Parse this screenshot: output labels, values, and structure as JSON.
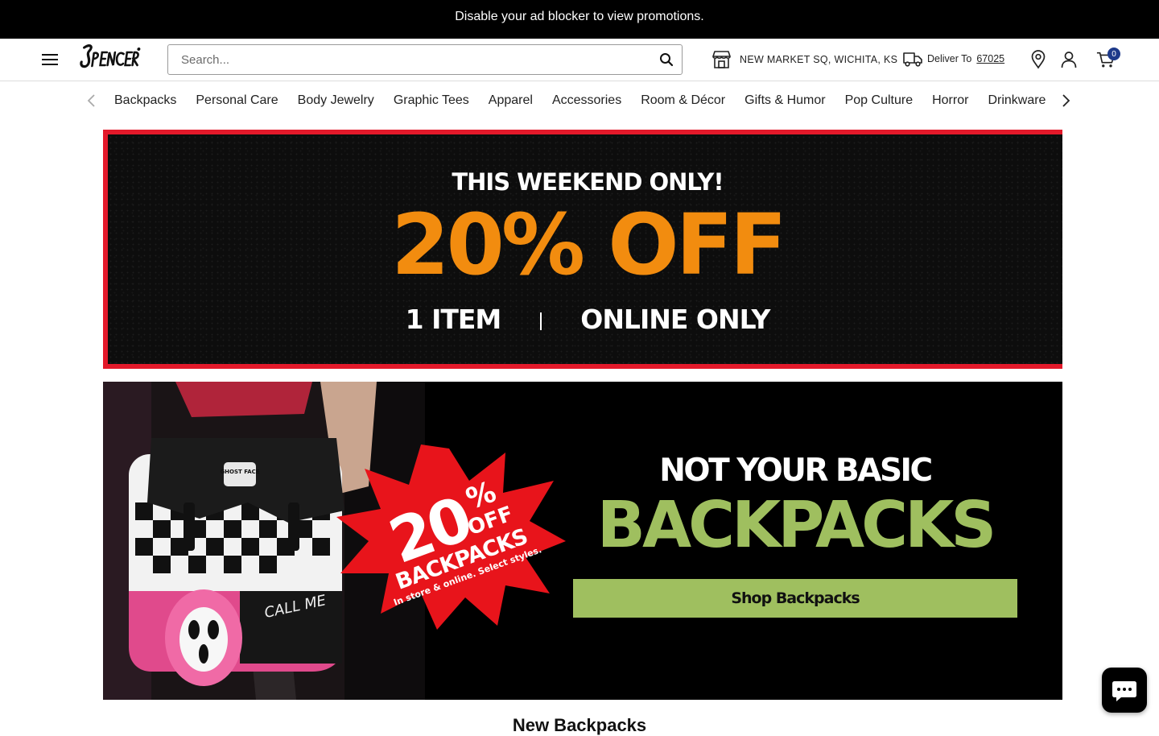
{
  "promo_bar": {
    "text": "Disable your ad blocker to view promotions."
  },
  "header": {
    "logo_text": "SPENCER'S",
    "search": {
      "placeholder": "Search...",
      "value": ""
    },
    "store_label": "NEW MARKET SQ, WICHITA, KS",
    "deliver_label": "Deliver To",
    "deliver_zip": "67025",
    "cart_count": "0",
    "icons": [
      "menu-icon",
      "search-icon",
      "store-icon",
      "truck-icon",
      "location-pin-icon",
      "account-icon",
      "cart-icon"
    ]
  },
  "category_nav": {
    "items": [
      "Backpacks",
      "Personal Care",
      "Body Jewelry",
      "Graphic Tees",
      "Apparel",
      "Accessories",
      "Room & Décor",
      "Gifts & Humor",
      "Pop Culture",
      "Horror",
      "Drinkware"
    ]
  },
  "banner_1": {
    "line1": "THIS WEEKEND ONLY!",
    "line2": "20% OFF",
    "line3_left": "1 ITEM",
    "line3_right": "ONLINE ONLY",
    "colors": {
      "border": "#e3192a",
      "accent": "#f28c0f"
    }
  },
  "banner_2": {
    "burst_big": "20",
    "burst_pct": "%",
    "burst_off": "OFF",
    "burst_backpacks": "BACKPACKS",
    "burst_note": "In store & online. Select styles.",
    "backpack_patch": "GHOST FACE",
    "backpack_print": "CALL ME",
    "title_line1": "NOT YOUR BASIC",
    "title_line2": "BACKPACKS",
    "cta": "Shop Backpacks",
    "colors": {
      "burst": "#e8141b",
      "accent": "#9fbf5f"
    }
  },
  "section_heading": "New Backpacks"
}
